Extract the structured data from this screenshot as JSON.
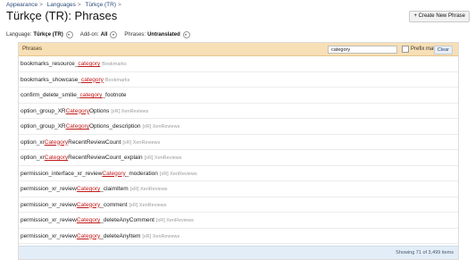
{
  "breadcrumb": [
    "Appearance",
    "Languages",
    "Türkçe (TR)"
  ],
  "title": "Türkçe (TR): Phrases",
  "create_button": "+ Create New Phrase",
  "filters": {
    "language_label": "Language:",
    "language_value": "Türkçe (TR)",
    "addon_label": "Add-on:",
    "addon_value": "All",
    "phrases_label": "Phrases:",
    "phrases_value": "Untranslated"
  },
  "panel": {
    "header_label": "Phrases",
    "search_value": "category",
    "prefix_label": "Prefix match",
    "clear_label": "Clear"
  },
  "rows": [
    {
      "pre": "bookmarks_resource_",
      "hl": "category",
      "post": "",
      "addon": "Bookmarks"
    },
    {
      "pre": "bookmarks_showcase_",
      "hl": "category",
      "post": "",
      "addon": "Bookmarks"
    },
    {
      "pre": "confirm_delete_smilie_",
      "hl": "category",
      "post": "_footnote",
      "addon": ""
    },
    {
      "pre": "option_group_XR",
      "hl": "Category",
      "post": "Options",
      "addon": "[xR] XenReviews"
    },
    {
      "pre": "option_group_XR",
      "hl": "Category",
      "post": "Options_description",
      "addon": "[xR] XenReviews"
    },
    {
      "pre": "option_xr",
      "hl": "Category",
      "post": "RecentReviewCount",
      "addon": "[xR] XenReviews"
    },
    {
      "pre": "option_xr",
      "hl": "Category",
      "post": "RecentReviewCount_explain",
      "addon": "[xR] XenReviews"
    },
    {
      "pre": "permission_interface_xr_review",
      "hl": "Category",
      "post": "_moderation",
      "addon": "[xR] XenReviews"
    },
    {
      "pre": "permission_xr_review",
      "hl": "Category",
      "post": "_claimItem",
      "addon": "[xR] XenReviews"
    },
    {
      "pre": "permission_xr_review",
      "hl": "Category",
      "post": "_comment",
      "addon": "[xR] XenReviews"
    },
    {
      "pre": "permission_xr_review",
      "hl": "Category",
      "post": "_deleteAnyComment",
      "addon": "[xR] XenReviews"
    },
    {
      "pre": "permission_xr_review",
      "hl": "Category",
      "post": "_deleteAnyItem",
      "addon": "[xR] XenReviews"
    },
    {
      "pre": "permission_xr_review",
      "hl": "Category",
      "post": "_deleteAnyReview",
      "addon": "[xR] XenReviews"
    }
  ],
  "footer": "Showing 71 of 3,499 items"
}
